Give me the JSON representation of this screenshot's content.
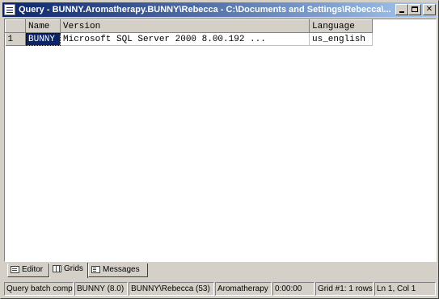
{
  "window": {
    "title": "Query - BUNNY.Aromatherapy.BUNNY\\Rebecca - C:\\Documents and Settings\\Rebecca\\..."
  },
  "grid": {
    "columns": [
      "Name",
      "Version",
      "Language"
    ],
    "rows": [
      {
        "num": "1",
        "cells": [
          "BUNNY",
          "Microsoft SQL Server  2000    8.00.192 ...",
          "us_english"
        ]
      }
    ]
  },
  "tabs": [
    {
      "label": "Editor",
      "icon": "editor-icon"
    },
    {
      "label": "Grids",
      "icon": "grids-icon"
    },
    {
      "label": "Messages",
      "icon": "messages-icon"
    }
  ],
  "status": {
    "message": "Query batch compl",
    "server": "BUNNY (8.0)",
    "user": "BUNNY\\Rebecca (53)",
    "database": "Aromatherapy",
    "elapsed": "0:00:00",
    "grid_info": "Grid #1: 1 rows",
    "position": "Ln 1, Col 1"
  },
  "colors": {
    "titlebar_start": "#0a246a",
    "titlebar_end": "#a6caf0",
    "selection": "#0a246a",
    "chrome": "#d4d0c8"
  }
}
